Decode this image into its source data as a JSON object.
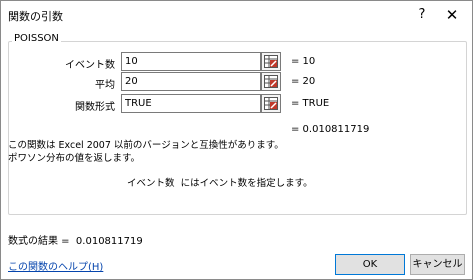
{
  "window": {
    "title": "関数の引数",
    "help_glyph": "?",
    "close_glyph": "✕"
  },
  "function_name": "POISSON",
  "arguments": [
    {
      "label": "イベント数",
      "value": "10",
      "result": "= 10"
    },
    {
      "label": "平均",
      "value": "20",
      "result": "= 20"
    },
    {
      "label": "関数形式",
      "value": "TRUE",
      "result": "= TRUE"
    }
  ],
  "formula_preview": "= 0.010811719",
  "description": {
    "line1": "この関数は Excel 2007 以前のバージョンと互換性があります。",
    "line2": "ポワソン分布の値を返します。"
  },
  "argument_help": {
    "name": "イベント数",
    "text": "にはイベント数を指定します。"
  },
  "result": {
    "label": "数式の結果 =",
    "value": "0.010811719"
  },
  "help_link": "この関数のヘルプ(H)",
  "buttons": {
    "ok": "OK",
    "cancel": "キャンセル"
  },
  "icons": {
    "ref_button": "collapse-dialog-icon"
  }
}
